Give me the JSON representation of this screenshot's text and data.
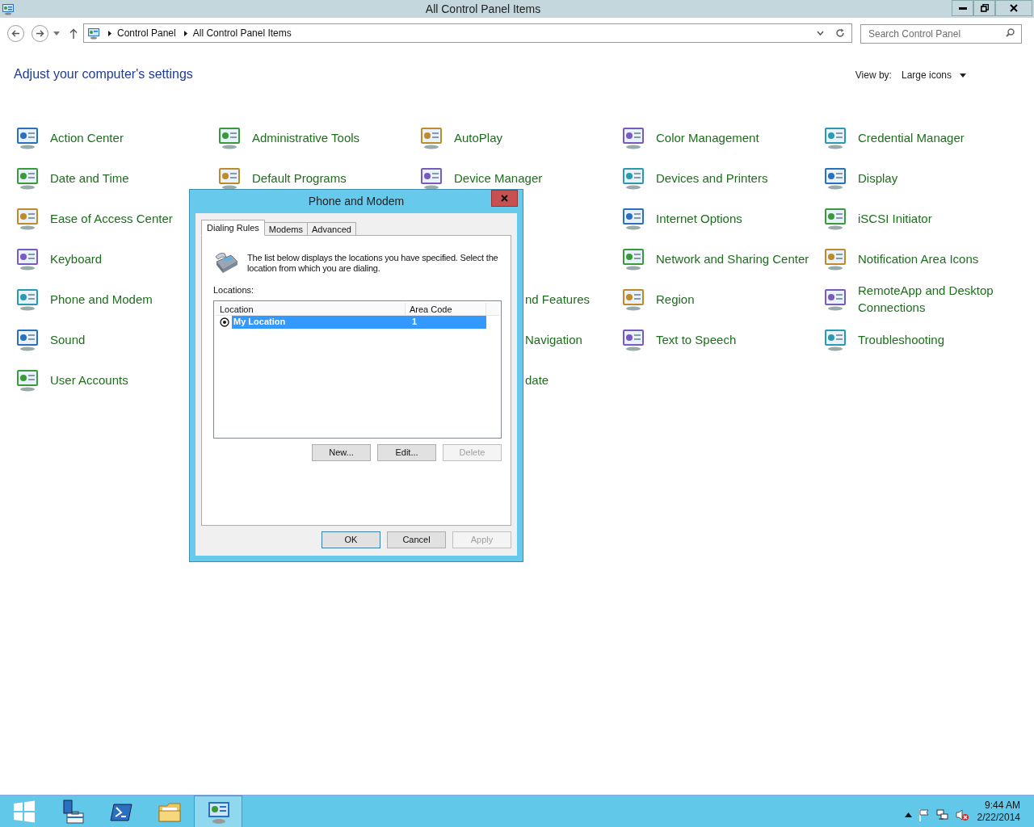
{
  "window": {
    "title": "All Control Panel Items"
  },
  "address_bar": {
    "breadcrumbs": [
      "Control Panel",
      "All Control Panel Items"
    ]
  },
  "search": {
    "placeholder": "Search Control Panel"
  },
  "heading": "Adjust your computer's settings",
  "view_by": {
    "label": "View by:",
    "value": "Large icons"
  },
  "columns": [
    {
      "items": [
        "Action Center",
        "Date and Time",
        "Ease of Access Center",
        "Keyboard",
        "Phone and Modem",
        "Sound",
        "User Accounts"
      ]
    },
    {
      "items": [
        "Administrative Tools",
        "Default Programs"
      ]
    },
    {
      "items": [
        "AutoPlay",
        "Device Manager"
      ]
    },
    {
      "items": [
        "Color Management",
        "Devices and Printers",
        "Internet Options",
        "Network and Sharing Center",
        "Region",
        "Text to Speech"
      ]
    },
    {
      "items": [
        "Credential Manager",
        "Display",
        "iSCSI Initiator",
        "Notification Area Icons",
        "RemoteApp and Desktop Connections",
        "Troubleshooting"
      ]
    }
  ],
  "partly_covered_items": [
    "nd Features",
    "Navigation",
    "date"
  ],
  "dialog": {
    "title": "Phone and Modem",
    "tabs": [
      {
        "label": "Dialing Rules",
        "selected": true
      },
      {
        "label": "Modems",
        "selected": false
      },
      {
        "label": "Advanced",
        "selected": false
      }
    ],
    "description": "The list below displays the locations you have specified. Select the location from which you are dialing.",
    "locations_label": "Locations:",
    "table": {
      "columns": [
        "Location",
        "Area Code"
      ],
      "rows": [
        {
          "location": "My Location",
          "area_code": "1",
          "selected": true
        }
      ]
    },
    "list_buttons": [
      {
        "label": "New...",
        "disabled": false
      },
      {
        "label": "Edit...",
        "disabled": false
      },
      {
        "label": "Delete",
        "disabled": true
      }
    ],
    "footer_buttons": [
      {
        "label": "OK",
        "disabled": false,
        "default": true
      },
      {
        "label": "Cancel",
        "disabled": false,
        "default": false
      },
      {
        "label": "Apply",
        "disabled": true,
        "default": false
      }
    ]
  },
  "taskbar": {
    "items": [
      {
        "kind": "start",
        "active": false
      },
      {
        "kind": "server-manager",
        "active": false
      },
      {
        "kind": "powershell",
        "active": false
      },
      {
        "kind": "explorer",
        "active": false
      },
      {
        "kind": "control-panel",
        "active": true
      }
    ],
    "time": "9:44 AM",
    "date": "2/22/2014"
  }
}
